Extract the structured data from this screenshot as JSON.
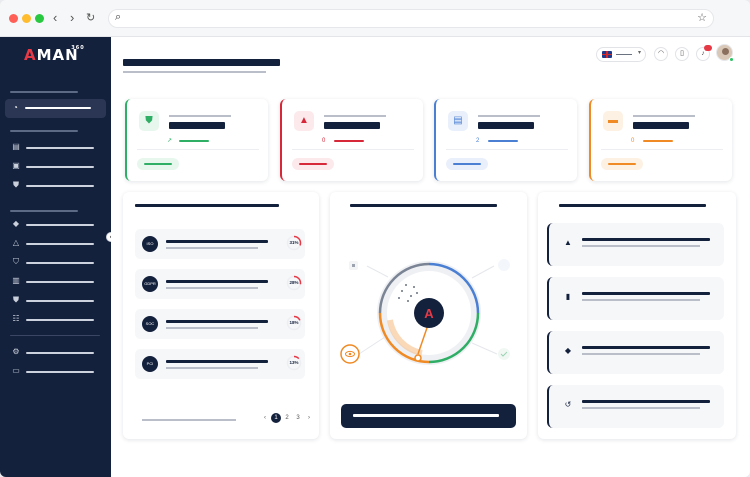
{
  "browser": {
    "back_glyph": "‹",
    "forward_glyph": "›",
    "reload_glyph": "↻",
    "search_glyph": "⌕",
    "star_glyph": "☆",
    "dot_colors": [
      "#ff5f57",
      "#febc2e",
      "#28c840"
    ]
  },
  "app": {
    "logo_first": "A",
    "logo_rest": "MAN",
    "logo_sup": "360"
  },
  "colors": {
    "navy": "#14213d",
    "green": "#2fae66",
    "red": "#d62839",
    "blue": "#4a7fd4",
    "orange": "#f08a24"
  },
  "stat_cards": [
    {
      "icon": "shield-icon",
      "glyph": "⛊",
      "trend": "↗",
      "accent": "#2fae66",
      "tint": "#e8f7ee"
    },
    {
      "icon": "warning-icon",
      "glyph": "▲",
      "trend": "0",
      "accent": "#d62839",
      "tint": "#fbe9eb"
    },
    {
      "icon": "clipboard-icon",
      "glyph": "▤",
      "trend": "2",
      "accent": "#4a7fd4",
      "tint": "#e9f0fb"
    },
    {
      "icon": "folder-icon",
      "glyph": "▬",
      "trend": "0",
      "accent": "#f08a24",
      "tint": "#fdf1e4"
    }
  ],
  "list_rows": [
    {
      "avatar": "ISO",
      "percent": "31%",
      "fraction": 0.31
    },
    {
      "avatar": "GDPR",
      "percent": "28%",
      "fraction": 0.28
    },
    {
      "avatar": "SOC",
      "percent": "18%",
      "fraction": 0.18
    },
    {
      "avatar": "PCI",
      "percent": "13%",
      "fraction": 0.13
    }
  ],
  "pagination": {
    "prev": "‹",
    "pages": [
      "1",
      "2",
      "3"
    ],
    "current": "1",
    "next": "›"
  },
  "feature_rows": [
    {
      "icon": "warning-icon",
      "glyph": "▲"
    },
    {
      "icon": "document-icon",
      "glyph": "▮"
    },
    {
      "icon": "eraser-icon",
      "glyph": "◆"
    },
    {
      "icon": "history-icon",
      "glyph": "↺"
    }
  ],
  "hub": {
    "center_glyph": "A"
  },
  "collapse_glyph": "‹"
}
